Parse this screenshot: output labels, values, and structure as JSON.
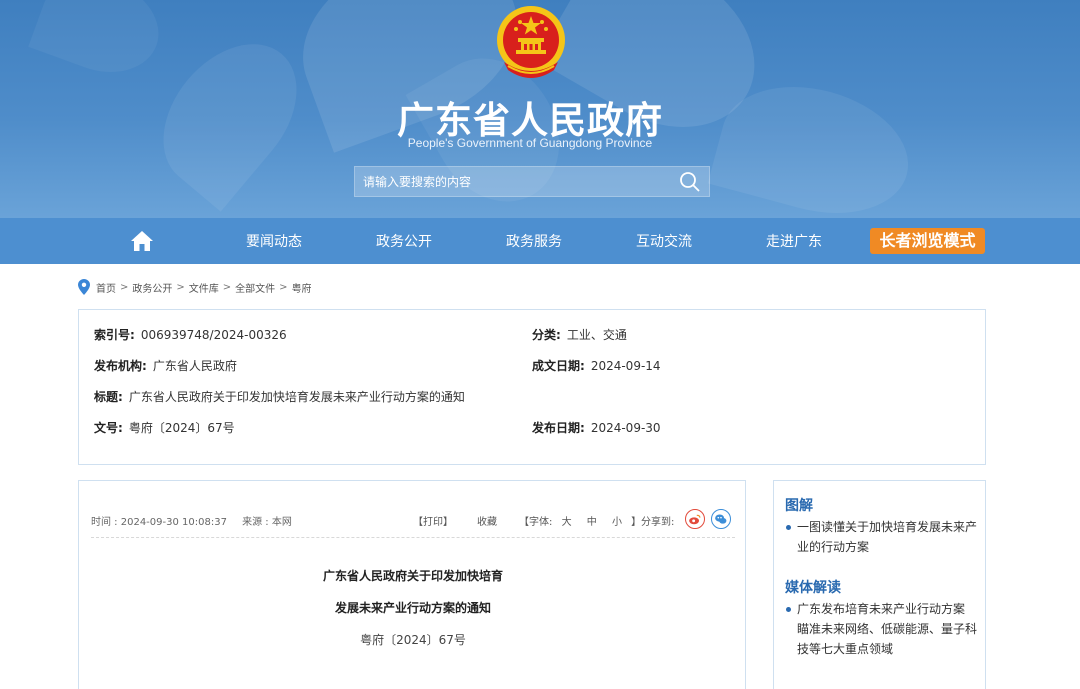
{
  "header": {
    "title": "广东省人民政府",
    "subtitle": "People's Government of Guangdong Province",
    "search_placeholder": "请输入要搜索的内容"
  },
  "nav": {
    "items": [
      "要闻动态",
      "政务公开",
      "政务服务",
      "互动交流",
      "走进广东"
    ],
    "elder_mode": "长者浏览模式"
  },
  "breadcrumb": [
    "首页",
    "政务公开",
    "文件库",
    "全部文件",
    "粤府"
  ],
  "info": {
    "index_label": "索引号:",
    "index_value": "006939748/2024-00326",
    "category_label": "分类:",
    "category_value": "工业、交通",
    "publisher_label": "发布机构:",
    "publisher_value": "广东省人民政府",
    "created_label": "成文日期:",
    "created_value": "2024-09-14",
    "title_label": "标题:",
    "title_value": "广东省人民政府关于印发加快培育发展未来产业行动方案的通知",
    "docno_label": "文号:",
    "docno_value": "粤府〔2024〕67号",
    "pubdate_label": "发布日期:",
    "pubdate_value": "2024-09-30"
  },
  "article": {
    "time": "时间 : 2024-09-30 10:08:37",
    "source": "来源 : 本网",
    "print": "【打印】",
    "favorite": "收藏",
    "font_label": "【字体:",
    "font_large": "大",
    "font_medium": "中",
    "font_small": "小",
    "font_close": "】",
    "share_label": "分享到:",
    "title_line1": "广东省人民政府关于印发加快培育",
    "title_line2": "发展未来产业行动方案的通知",
    "doc_number": "粤府〔2024〕67号"
  },
  "sidebar": {
    "graphic_heading": "图解",
    "graphic_item": "一图读懂关于加快培育发展未来产业的行动方案",
    "media_heading": "媒体解读",
    "media_item": "广东发布培育未来产业行动方案 瞄准未来网络、低碳能源、量子科技等七大重点领域"
  },
  "colors": {
    "header_blue": "#4f8dca",
    "nav_blue": "#4d8fd0",
    "elder_orange": "#f08a24",
    "sidebar_heading": "#2a6ab0",
    "emblem_red": "#d8201c",
    "emblem_gold": "#f5c518"
  },
  "icons": [
    "national-emblem-icon",
    "search-icon",
    "home-icon",
    "location-pin-icon",
    "weibo-icon",
    "wechat-icon"
  ]
}
